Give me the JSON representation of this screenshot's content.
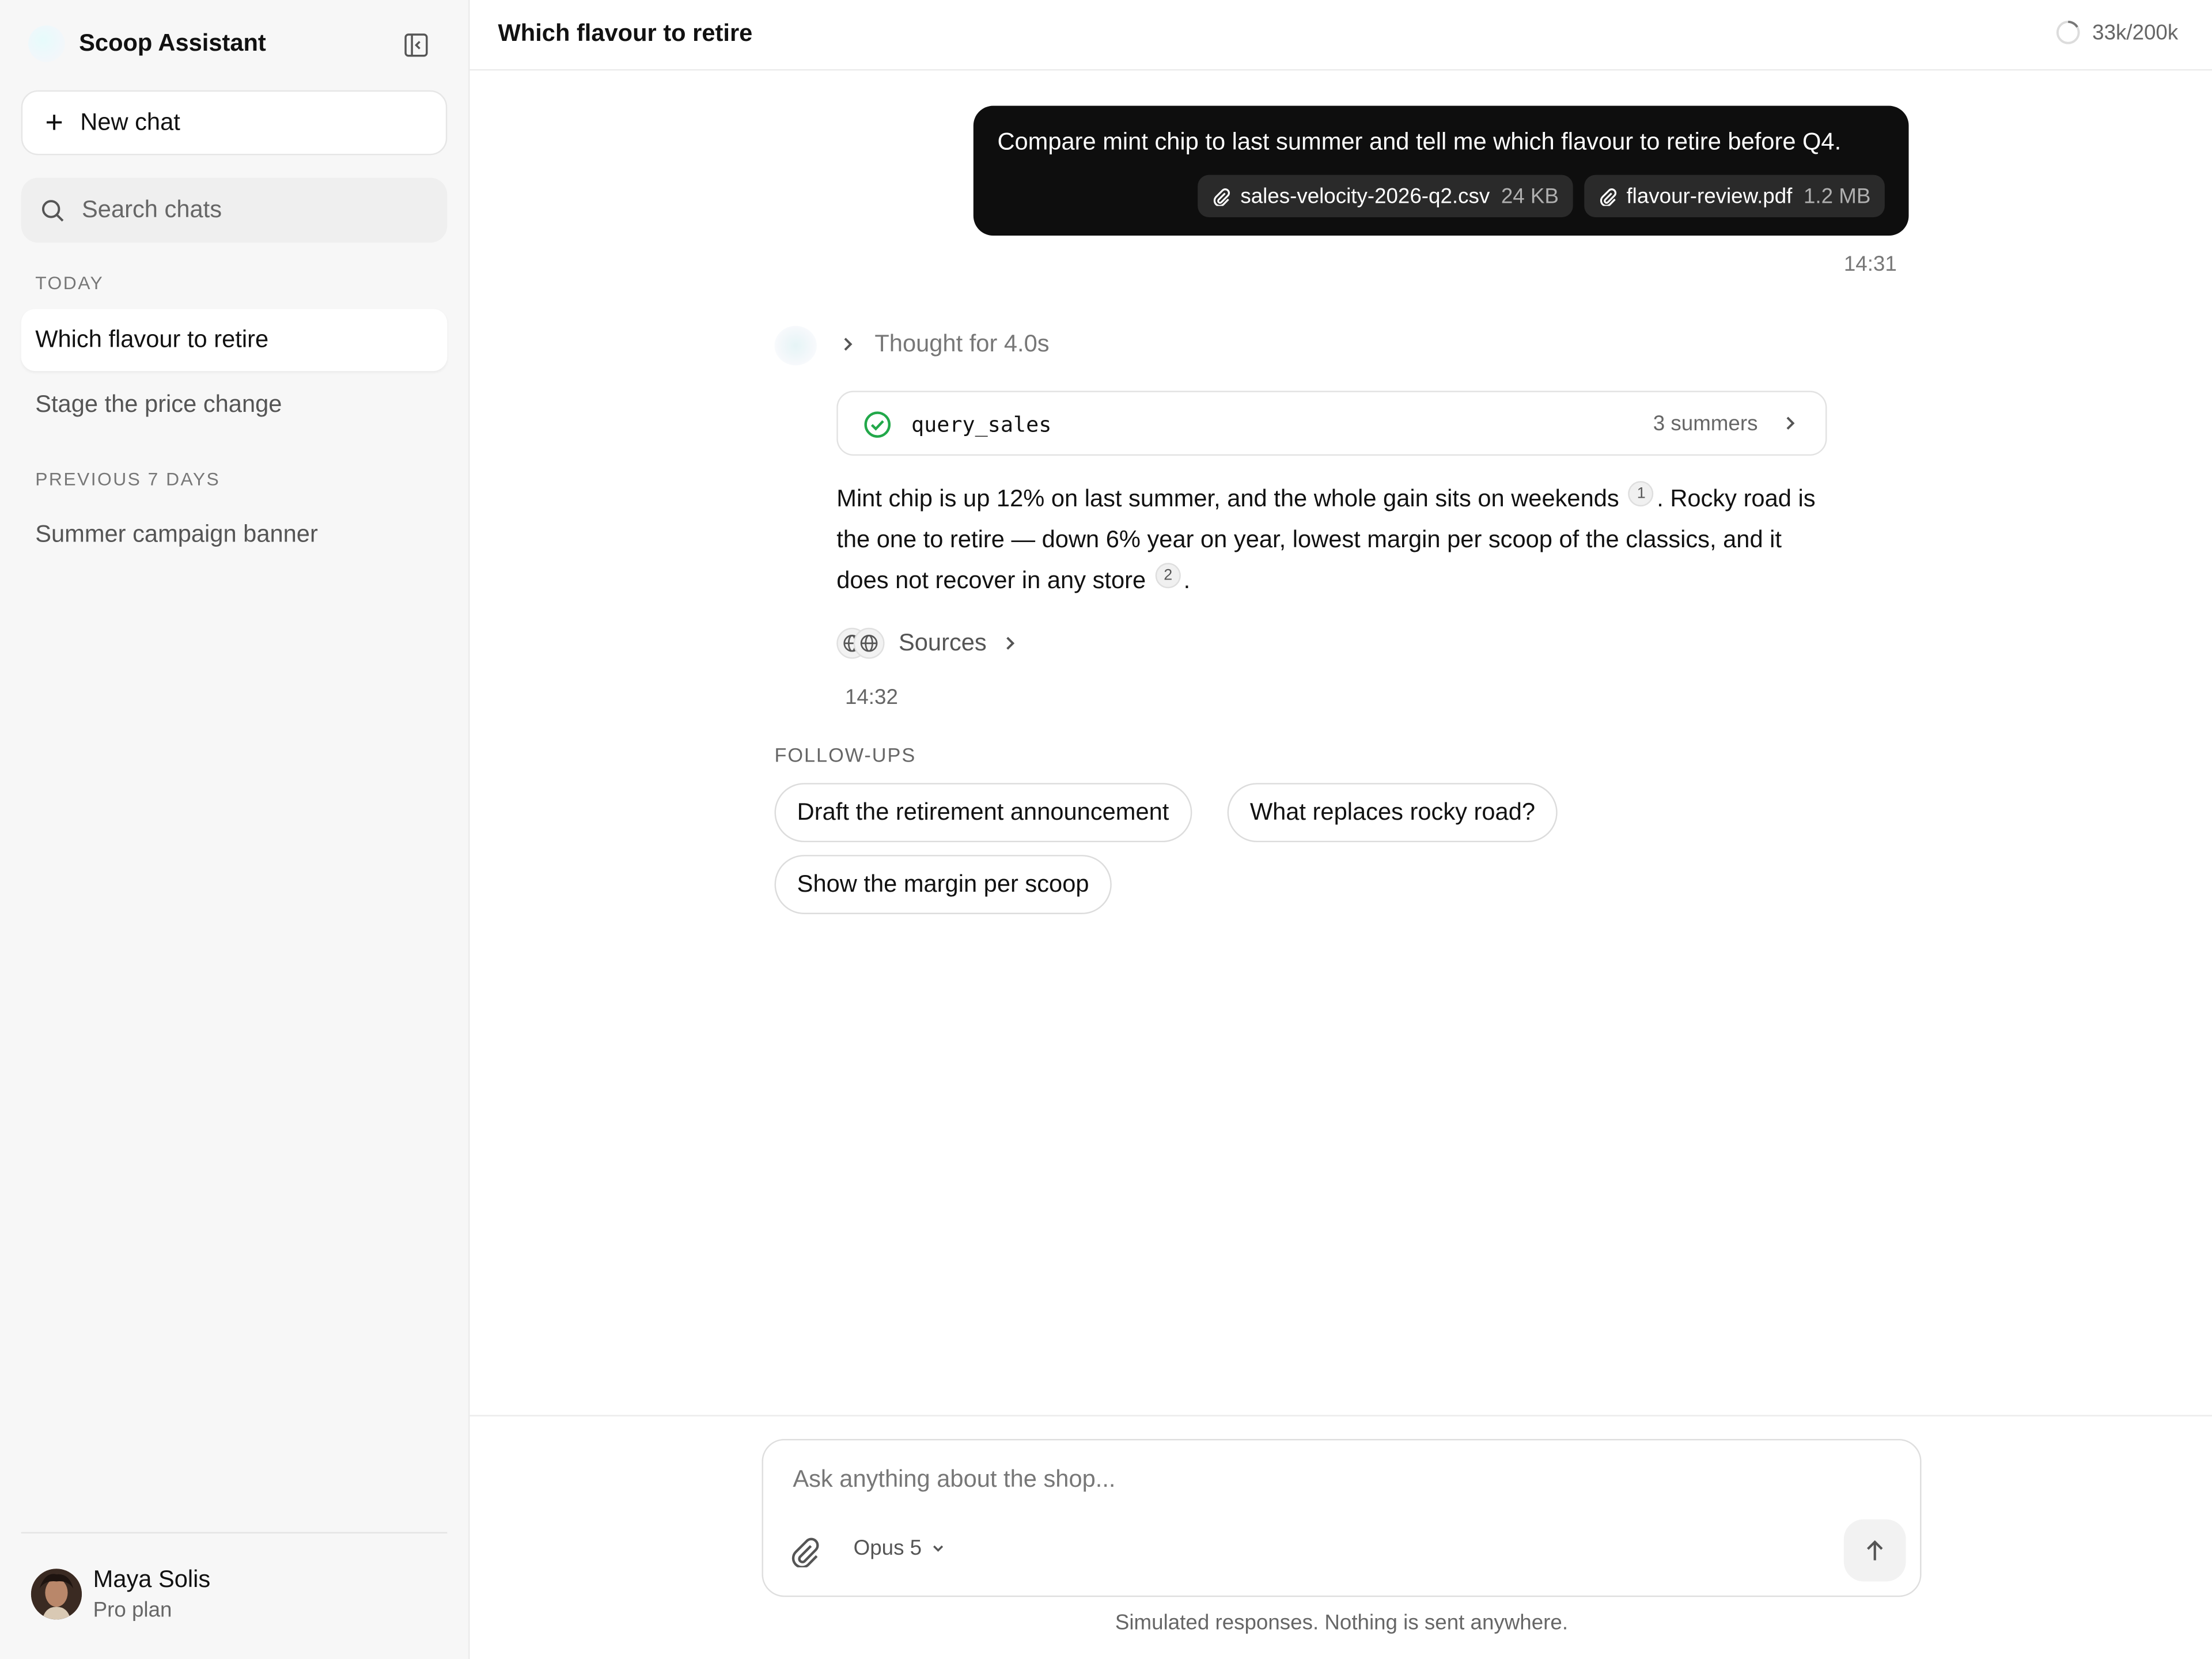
{
  "sidebar": {
    "brand": "Scoop Assistant",
    "new_chat": "New chat",
    "search_placeholder": "Search chats",
    "sections": {
      "today": "TODAY",
      "previous": "PREVIOUS 7 DAYS"
    },
    "today_items": [
      "Which flavour to retire",
      "Stage the price change"
    ],
    "previous_items": [
      "Summer campaign banner"
    ],
    "user": {
      "name": "Maya Solis",
      "plan": "Pro plan"
    }
  },
  "header": {
    "title": "Which flavour to retire",
    "context_usage": "33k/200k",
    "context_fraction": 0.165
  },
  "conversation": {
    "user_message": {
      "text": "Compare mint chip to last summer and tell me which flavour to retire before Q4.",
      "attachments": [
        {
          "name": "sales-velocity-2026-q2.csv",
          "size": "24 KB"
        },
        {
          "name": "flavour-review.pdf",
          "size": "1.2 MB"
        }
      ],
      "time": "14:31"
    },
    "assistant": {
      "thought": "Thought for 4.0s",
      "tool": {
        "name": "query_sales",
        "meta": "3 summers"
      },
      "answer": {
        "part1": "Mint chip is up 12% on last summer, and the whole gain sits on weekends",
        "cite1": "1",
        "part2": ". Rocky road is the one to retire — down 6% year on year, lowest margin per scoop of the classics, and it does not recover in any store",
        "cite2": "2",
        "part3": "."
      },
      "sources": "Sources",
      "time": "14:32"
    },
    "followups": {
      "label": "FOLLOW-UPS",
      "items": [
        "Draft the retirement announcement",
        "What replaces rocky road?",
        "Show the margin per scoop"
      ]
    }
  },
  "composer": {
    "placeholder": "Ask anything about the shop...",
    "model": "Opus 5",
    "disclaimer": "Simulated responses. Nothing is sent anywhere."
  },
  "colors": {
    "user_bubble": "#0e0e0e",
    "success": "#22a84a",
    "sidebar_bg": "#f7f7f7"
  }
}
